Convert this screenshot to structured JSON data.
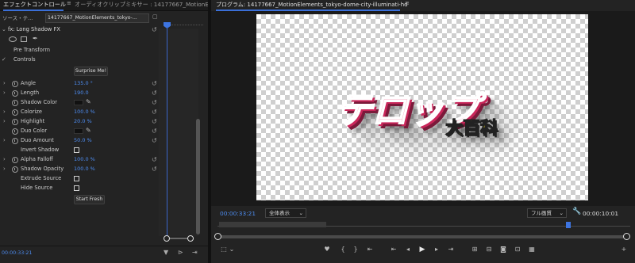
{
  "effect_panel": {
    "tabs": [
      {
        "label": "エフェクトコントロール"
      },
      {
        "label": "オーディオクリップミキサー : 14177667_MotionE"
      }
    ],
    "source_label": "ソース・テ...",
    "clip_label": "14177667_MotionElements_tokyo-...",
    "effect_name": "Long Shadow FX",
    "effect_prefix": "fx",
    "pre_transform_label": "Pre Transform",
    "controls_label": "Controls",
    "surprise_button": "Surprise Me!",
    "start_fresh_button": "Start Fresh",
    "params": [
      {
        "label": "Angle",
        "value": "135.0 °",
        "type": "value",
        "expandable": true
      },
      {
        "label": "Length",
        "value": "190.0",
        "type": "value",
        "expandable": true
      },
      {
        "label": "Shadow Color",
        "type": "color"
      },
      {
        "label": "Colorize",
        "value": "100.0 %",
        "type": "value",
        "expandable": true
      },
      {
        "label": "Highlight",
        "value": "20.0 %",
        "type": "value",
        "expandable": true
      },
      {
        "label": "Duo Color",
        "type": "color"
      },
      {
        "label": "Duo Amount",
        "value": "50.0 %",
        "type": "value",
        "expandable": true
      },
      {
        "label": "Invert Shadow",
        "type": "checkbox"
      },
      {
        "label": "Alpha Falloff",
        "value": "100.0 %",
        "type": "value",
        "expandable": true
      },
      {
        "label": "Shadow Opacity",
        "value": "100.0 %",
        "type": "value",
        "expandable": true
      },
      {
        "label": "Extrude Source",
        "type": "checkbox"
      },
      {
        "label": "Hide Source",
        "type": "checkbox"
      }
    ],
    "timecode": "00:00:33:21"
  },
  "program_monitor": {
    "title": "プログラム: 14177667_MotionElements_tokyo-dome-city-illuminati-hd",
    "overlay_text_main": "テロップ",
    "overlay_text_sub": "大百科",
    "timecode_current": "00:00:33:21",
    "fit_select": "全体表示",
    "quality_select": "フル画質",
    "timecode_duration": "00:00:10:01"
  },
  "colors": {
    "accent": "#3d74e0",
    "timecode": "#4d8cf0",
    "title_main": "#f25a86",
    "title_sub": "#f4e01d"
  }
}
